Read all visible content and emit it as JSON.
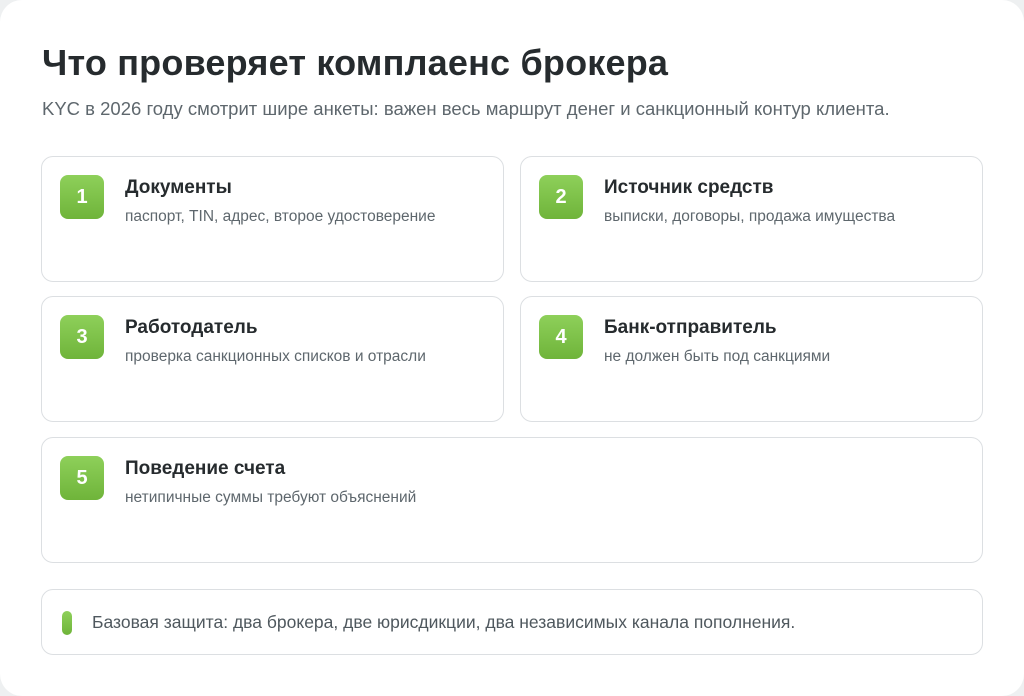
{
  "header": {
    "title": "Что проверяет комплаенс брокера",
    "subtitle": "KYC в 2026 году смотрит шире анкеты: важен весь маршрут денег и санкционный контур клиента."
  },
  "cards": [
    {
      "num": "1",
      "title": "Документы",
      "desc": "паспорт, TIN, адрес, второе удостоверение"
    },
    {
      "num": "2",
      "title": "Источник средств",
      "desc": "выписки, договоры, продажа имущества"
    },
    {
      "num": "3",
      "title": "Работодатель",
      "desc": "проверка санкционных списков и отрасли"
    },
    {
      "num": "4",
      "title": "Банк-отправитель",
      "desc": "не должен быть под санкциями"
    },
    {
      "num": "5",
      "title": "Поведение счета",
      "desc": "нетипичные суммы требуют объяснений"
    }
  ],
  "note": {
    "text": "Базовая защита: два брокера, две юрисдикции, два независимых канала пополнения."
  },
  "colors": {
    "accent": "#7cc146",
    "text": "#262b2e",
    "muted": "#5e676d",
    "border": "#dcdfe2"
  }
}
